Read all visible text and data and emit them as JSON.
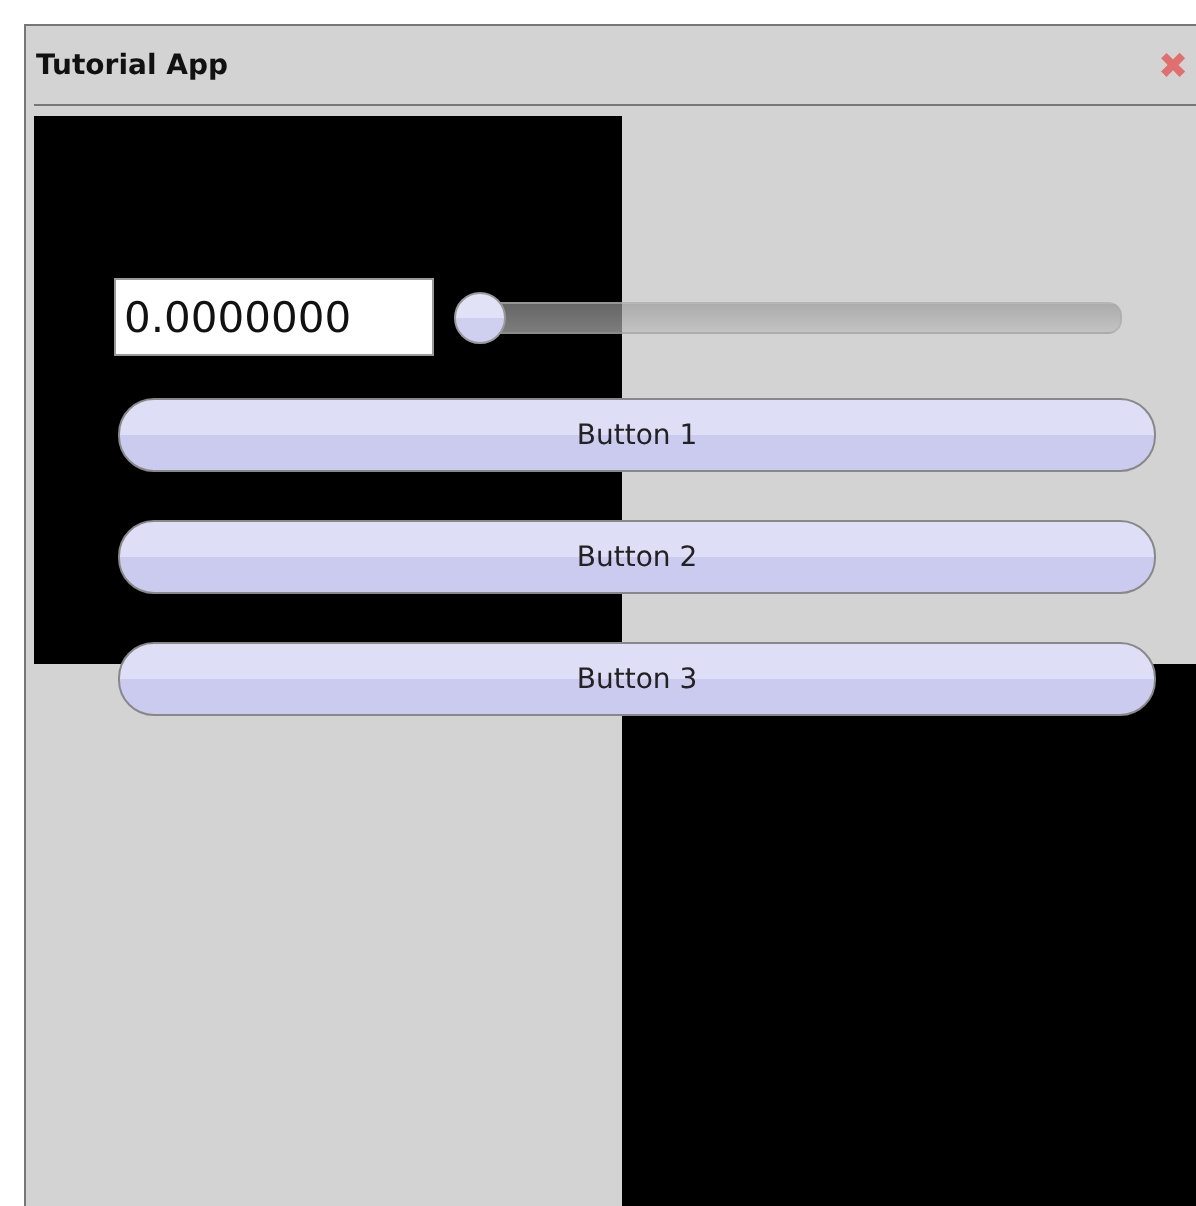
{
  "window": {
    "title": "Tutorial App",
    "close": "✖"
  },
  "field": {
    "value": "0.0000000"
  },
  "slider": {
    "level": 0
  },
  "buttons": [
    {
      "label": "Button 1"
    },
    {
      "label": "Button 2"
    },
    {
      "label": "Button 3"
    }
  ]
}
